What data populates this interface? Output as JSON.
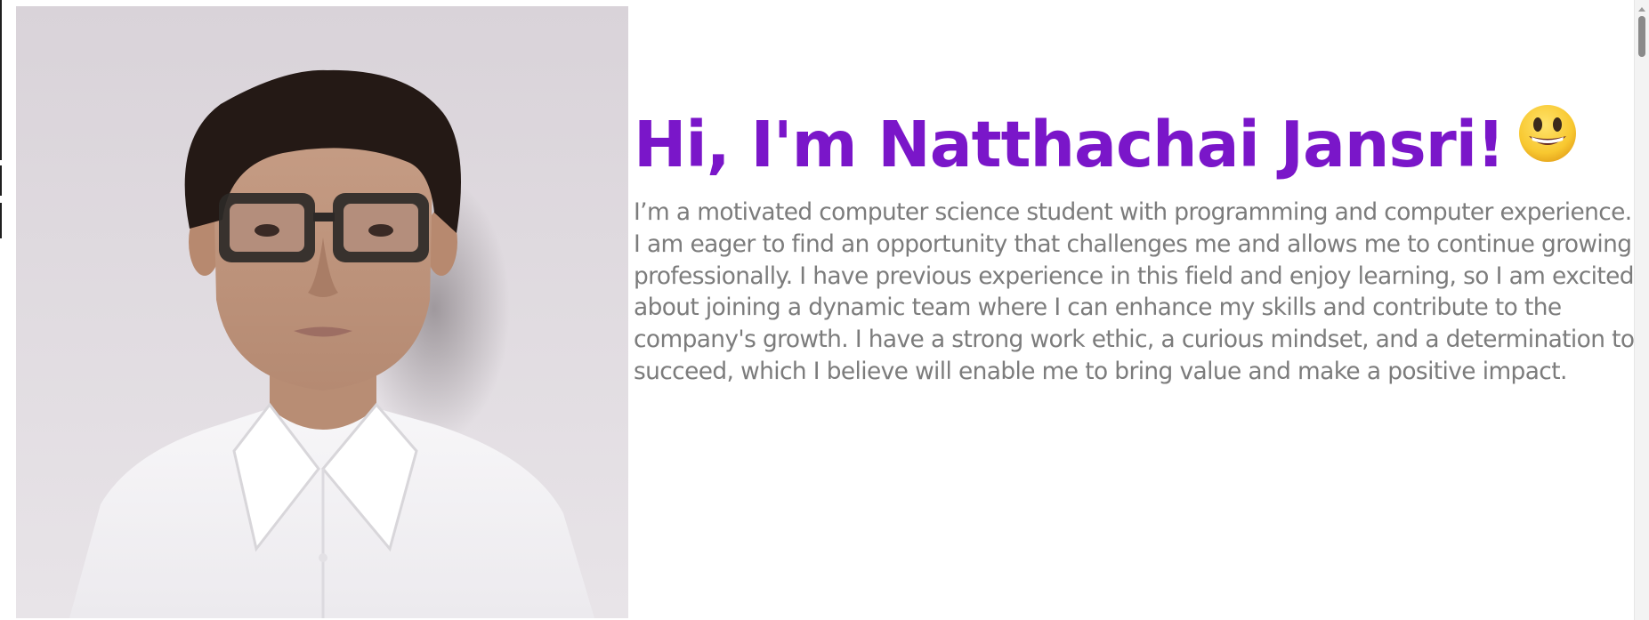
{
  "profile": {
    "greeting": "Hi, I'm Natthachai Jansri!",
    "greeting_icon": "grinning-face-emoji",
    "bio": "I’m a motivated computer science student with programming and computer experience. I am eager to find an opportunity that challenges me and allows me to continue growing professionally. I have previous experience in this field and enjoy learning, so I am excited about joining a dynamic team where I can enhance my skills and contribute to the company's growth. I have a strong work ethic, a curious mindset, and a determination to succeed, which I believe will enable me to bring value and make a positive impact.",
    "photo_icon": "profile-photo"
  },
  "colors": {
    "heading": "#7a16c9",
    "body_text": "#7c7c7c",
    "background": "#ffffff"
  }
}
